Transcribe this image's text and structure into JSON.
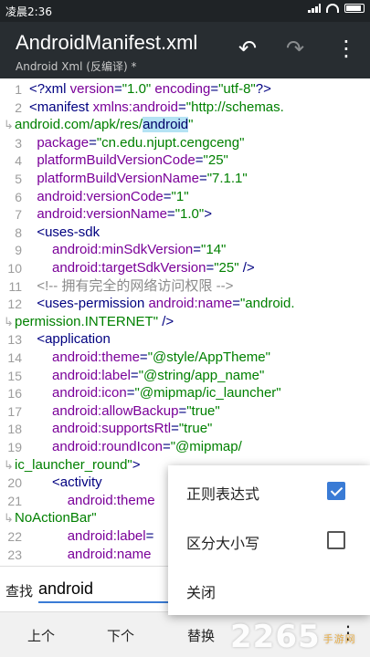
{
  "status": {
    "time": "凌晨2:36"
  },
  "appbar": {
    "title": "AndroidManifest.xml",
    "subtitle": "Android Xml (反编译) *",
    "undo_icon": "undo-icon",
    "redo_icon": "redo-icon",
    "more_icon": "more-vert-icon"
  },
  "lines": [
    {
      "n": "1",
      "parts": [
        [
          "tag",
          "<?xml "
        ],
        [
          "attr",
          "version"
        ],
        [
          "tag",
          "="
        ],
        [
          "val",
          "\"1.0\""
        ],
        [
          "tag",
          " "
        ],
        [
          "attr",
          "encoding"
        ],
        [
          "tag",
          "="
        ],
        [
          "val",
          "\"utf-8\""
        ],
        [
          "tag",
          "?>"
        ]
      ]
    },
    {
      "n": "2",
      "parts": [
        [
          "tag",
          "<manifest "
        ],
        [
          "attr",
          "xmlns:android"
        ],
        [
          "tag",
          "="
        ],
        [
          "val",
          "\"http://schemas."
        ]
      ]
    },
    {
      "n": "",
      "cont": true,
      "parts": [
        [
          "val",
          "android.com/apk/res/"
        ],
        [
          "hl",
          "android"
        ],
        [
          "val",
          "\""
        ]
      ]
    },
    {
      "n": "3",
      "parts": [
        [
          "tag",
          "  "
        ],
        [
          "attr",
          "package"
        ],
        [
          "tag",
          "="
        ],
        [
          "val",
          "\"cn.edu.njupt.cengceng\""
        ]
      ]
    },
    {
      "n": "4",
      "parts": [
        [
          "tag",
          "  "
        ],
        [
          "attr",
          "platformBuildVersionCode"
        ],
        [
          "tag",
          "="
        ],
        [
          "val",
          "\"25\""
        ]
      ]
    },
    {
      "n": "5",
      "parts": [
        [
          "tag",
          "  "
        ],
        [
          "attr",
          "platformBuildVersionName"
        ],
        [
          "tag",
          "="
        ],
        [
          "val",
          "\"7.1.1\""
        ]
      ]
    },
    {
      "n": "6",
      "parts": [
        [
          "tag",
          "  "
        ],
        [
          "attr",
          "android:versionCode"
        ],
        [
          "tag",
          "="
        ],
        [
          "val",
          "\"1\""
        ]
      ]
    },
    {
      "n": "7",
      "parts": [
        [
          "tag",
          "  "
        ],
        [
          "attr",
          "android:versionName"
        ],
        [
          "tag",
          "="
        ],
        [
          "val",
          "\"1.0\""
        ],
        [
          "tag",
          ">"
        ]
      ]
    },
    {
      "n": "8",
      "parts": [
        [
          "tag",
          "  <uses-sdk"
        ]
      ]
    },
    {
      "n": "9",
      "parts": [
        [
          "tag",
          "      "
        ],
        [
          "attr",
          "android:minSdkVersion"
        ],
        [
          "tag",
          "="
        ],
        [
          "val",
          "\"14\""
        ]
      ]
    },
    {
      "n": "10",
      "parts": [
        [
          "tag",
          "      "
        ],
        [
          "attr",
          "android:targetSdkVersion"
        ],
        [
          "tag",
          "="
        ],
        [
          "val",
          "\"25\""
        ],
        [
          "tag",
          " />"
        ]
      ]
    },
    {
      "n": "11",
      "parts": [
        [
          "cmt",
          "  <!-- 拥有完全的网络访问权限 -->"
        ]
      ]
    },
    {
      "n": "12",
      "parts": [
        [
          "tag",
          "  <uses-permission "
        ],
        [
          "attr",
          "android:name"
        ],
        [
          "tag",
          "="
        ],
        [
          "val",
          "\"android."
        ]
      ]
    },
    {
      "n": "",
      "cont": true,
      "parts": [
        [
          "val",
          "permission.INTERNET\""
        ],
        [
          "tag",
          " />"
        ]
      ]
    },
    {
      "n": "13",
      "parts": [
        [
          "tag",
          "  <application"
        ]
      ]
    },
    {
      "n": "14",
      "parts": [
        [
          "tag",
          "      "
        ],
        [
          "attr",
          "android:theme"
        ],
        [
          "tag",
          "="
        ],
        [
          "val",
          "\"@style/AppTheme\""
        ]
      ]
    },
    {
      "n": "15",
      "parts": [
        [
          "tag",
          "      "
        ],
        [
          "attr",
          "android:label"
        ],
        [
          "tag",
          "="
        ],
        [
          "val",
          "\"@string/app_name\""
        ]
      ]
    },
    {
      "n": "16",
      "parts": [
        [
          "tag",
          "      "
        ],
        [
          "attr",
          "android:icon"
        ],
        [
          "tag",
          "="
        ],
        [
          "val",
          "\"@mipmap/ic_launcher\""
        ]
      ]
    },
    {
      "n": "17",
      "parts": [
        [
          "tag",
          "      "
        ],
        [
          "attr",
          "android:allowBackup"
        ],
        [
          "tag",
          "="
        ],
        [
          "val",
          "\"true\""
        ]
      ]
    },
    {
      "n": "18",
      "parts": [
        [
          "tag",
          "      "
        ],
        [
          "attr",
          "android:supportsRtl"
        ],
        [
          "tag",
          "="
        ],
        [
          "val",
          "\"true\""
        ]
      ]
    },
    {
      "n": "19",
      "parts": [
        [
          "tag",
          "      "
        ],
        [
          "attr",
          "android:roundIcon"
        ],
        [
          "tag",
          "="
        ],
        [
          "val",
          "\"@mipmap/"
        ]
      ]
    },
    {
      "n": "",
      "cont": true,
      "parts": [
        [
          "val",
          "ic_launcher_round\""
        ],
        [
          "tag",
          ">"
        ]
      ]
    },
    {
      "n": "20",
      "parts": [
        [
          "tag",
          "      <activity"
        ]
      ]
    },
    {
      "n": "21",
      "parts": [
        [
          "tag",
          "          "
        ],
        [
          "attr",
          "android:theme"
        ]
      ]
    },
    {
      "n": "",
      "cont": true,
      "parts": [
        [
          "val",
          "NoActionBar\""
        ]
      ]
    },
    {
      "n": "22",
      "parts": [
        [
          "tag",
          "          "
        ],
        [
          "attr",
          "android:label"
        ],
        [
          "tag",
          "="
        ]
      ]
    },
    {
      "n": "23",
      "parts": [
        [
          "tag",
          "          "
        ],
        [
          "attr",
          "android:name"
        ]
      ]
    }
  ],
  "find": {
    "label": "查找",
    "value": "android"
  },
  "bottom": {
    "prev": "上个",
    "next": "下个",
    "replace": "替换",
    "more_icon": "more-vert-icon"
  },
  "menu": {
    "regex": {
      "label": "正则表达式",
      "checked": true
    },
    "case": {
      "label": "区分大小写",
      "checked": false
    },
    "close": {
      "label": "关闭"
    }
  },
  "watermark": {
    "text": "2265",
    "sub": "手游网"
  }
}
